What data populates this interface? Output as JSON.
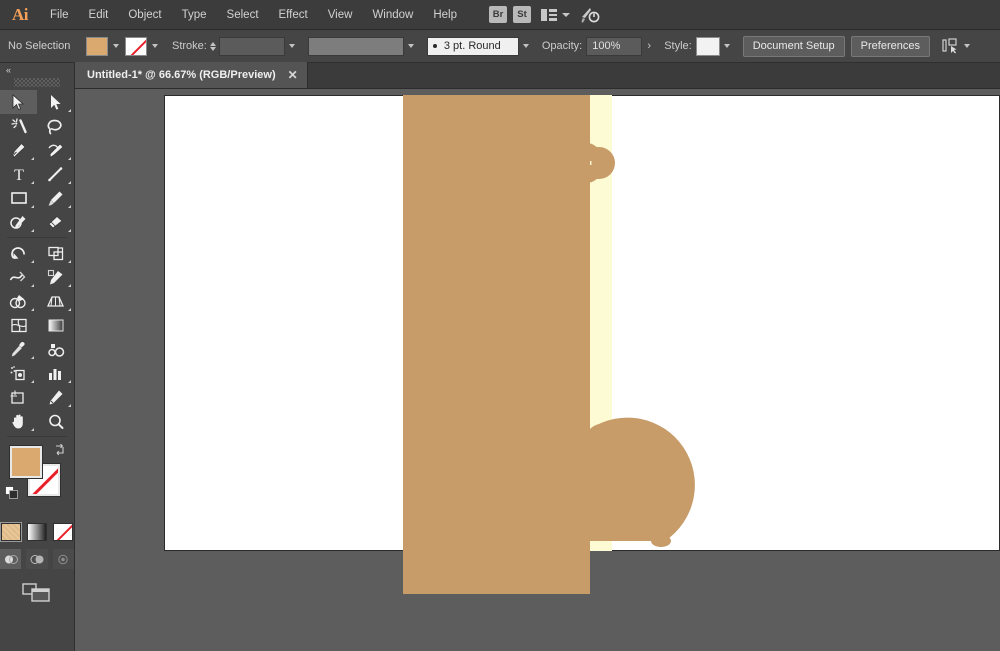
{
  "app": {
    "name": "Adobe Illustrator",
    "logo_text": "Ai"
  },
  "menubar": {
    "items": [
      {
        "label": "File"
      },
      {
        "label": "Edit"
      },
      {
        "label": "Object"
      },
      {
        "label": "Type"
      },
      {
        "label": "Select"
      },
      {
        "label": "Effect"
      },
      {
        "label": "View"
      },
      {
        "label": "Window"
      },
      {
        "label": "Help"
      }
    ],
    "bridge_badge": "Br",
    "stock_badge": "St"
  },
  "controlbar": {
    "selection_state": "No Selection",
    "fill_color": "#d9a96f",
    "stroke_color": "none",
    "stroke_label": "Stroke:",
    "stroke_weight": "",
    "stroke_profile": "",
    "brush_definition": "3 pt. Round",
    "opacity_label": "Opacity:",
    "opacity_value": "100%",
    "style_label": "Style:",
    "style_swatch": "#f2f2f2",
    "document_setup_label": "Document Setup",
    "preferences_label": "Preferences"
  },
  "tabbar": {
    "document_tab": "Untitled-1* @ 66.67% (RGB/Preview)",
    "close_glyph": "✕"
  },
  "toolpanel": {
    "collapse_glyph": "«",
    "tools": [
      {
        "name": "selection-tool",
        "selected": true,
        "has_flyout": false
      },
      {
        "name": "direct-selection-tool",
        "selected": false,
        "has_flyout": true
      },
      {
        "name": "magic-wand-tool",
        "selected": false,
        "has_flyout": false
      },
      {
        "name": "lasso-tool",
        "selected": false,
        "has_flyout": false
      },
      {
        "name": "pen-tool",
        "selected": false,
        "has_flyout": true
      },
      {
        "name": "curvature-tool",
        "selected": false,
        "has_flyout": true
      },
      {
        "name": "type-tool",
        "selected": false,
        "has_flyout": true
      },
      {
        "name": "line-segment-tool",
        "selected": false,
        "has_flyout": true
      },
      {
        "name": "rectangle-tool",
        "selected": false,
        "has_flyout": true
      },
      {
        "name": "paintbrush-tool",
        "selected": false,
        "has_flyout": true
      },
      {
        "name": "shaper-tool",
        "selected": false,
        "has_flyout": true
      },
      {
        "name": "eraser-tool",
        "selected": false,
        "has_flyout": true
      },
      {
        "name": "rotate-tool",
        "selected": false,
        "has_flyout": true
      },
      {
        "name": "scale-tool",
        "selected": false,
        "has_flyout": true
      },
      {
        "name": "width-tool",
        "selected": false,
        "has_flyout": true
      },
      {
        "name": "free-transform-tool",
        "selected": false,
        "has_flyout": false
      },
      {
        "name": "shape-builder-tool",
        "selected": false,
        "has_flyout": true
      },
      {
        "name": "perspective-grid-tool",
        "selected": false,
        "has_flyout": true
      },
      {
        "name": "mesh-tool",
        "selected": false,
        "has_flyout": false
      },
      {
        "name": "gradient-tool",
        "selected": false,
        "has_flyout": false
      },
      {
        "name": "eyedropper-tool",
        "selected": false,
        "has_flyout": true
      },
      {
        "name": "blend-tool",
        "selected": false,
        "has_flyout": false
      },
      {
        "name": "symbol-sprayer-tool",
        "selected": false,
        "has_flyout": true
      },
      {
        "name": "column-graph-tool",
        "selected": false,
        "has_flyout": true
      },
      {
        "name": "artboard-tool",
        "selected": false,
        "has_flyout": false
      },
      {
        "name": "slice-tool",
        "selected": false,
        "has_flyout": true
      },
      {
        "name": "hand-tool",
        "selected": false,
        "has_flyout": true
      },
      {
        "name": "zoom-tool",
        "selected": false,
        "has_flyout": false
      }
    ],
    "fill_color": "#d9a96f",
    "stroke_color": "none",
    "color_mode_buttons": [
      "color",
      "gradient",
      "none"
    ],
    "active_color_mode": "color",
    "draw_modes": [
      "draw-normal",
      "draw-behind",
      "draw-inside"
    ],
    "active_draw_mode": "draw-normal",
    "screen_mode": "change-screen-mode"
  },
  "canvas": {
    "background_color": "#5d5d5d",
    "artboard_color": "#ffffff",
    "artwork": {
      "description": "mug silhouette",
      "body_color": "#c79c69",
      "highlight_color": "#fdfbd3",
      "shapes": [
        {
          "name": "mug-body-rect",
          "color": "#c79c69"
        },
        {
          "name": "mug-handle",
          "color": "#c79c69"
        },
        {
          "name": "mug-handle-inner",
          "color": "#fdfbd3"
        },
        {
          "name": "yellow-highlight-strip",
          "color": "#fdfbd3"
        },
        {
          "name": "mug-base-dome",
          "color": "#c79c69"
        }
      ]
    }
  }
}
